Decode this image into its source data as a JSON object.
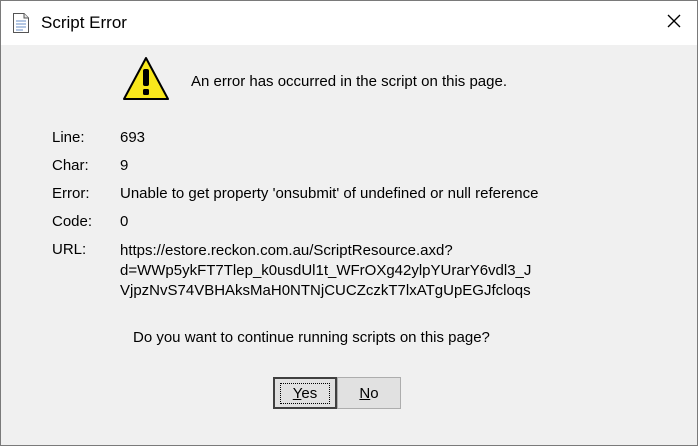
{
  "window": {
    "title": "Script Error",
    "icons": {
      "title": "document-icon",
      "close": "close-icon",
      "warning": "warning-icon"
    }
  },
  "message": "An error has occurred in the script on this page.",
  "details": {
    "line_label": "Line:",
    "line_value": "693",
    "char_label": "Char:",
    "char_value": "9",
    "error_label": "Error:",
    "error_value": "Unable to get property 'onsubmit' of undefined or null reference",
    "code_label": "Code:",
    "code_value": "0",
    "url_label": "URL:",
    "url_line1": "https://estore.reckon.com.au/ScriptResource.axd?",
    "url_line2": "d=WWp5ykFT7Tlep_k0usdUl1t_WFrOXg42ylpYUrarY6vdl3_J",
    "url_line3": "VjpzNvS74VBHAksMaH0NTNjCUCZczkT7lxATgUpEGJfcloqs"
  },
  "question": "Do you want to continue running scripts on this page?",
  "buttons": {
    "yes_mnemonic": "Y",
    "yes_rest": "es",
    "no_mnemonic": "N",
    "no_rest": "o"
  },
  "colors": {
    "warning_fill": "#f8e71c",
    "dialog_bg": "#f0f0f0",
    "titlebar_bg": "#ffffff"
  }
}
